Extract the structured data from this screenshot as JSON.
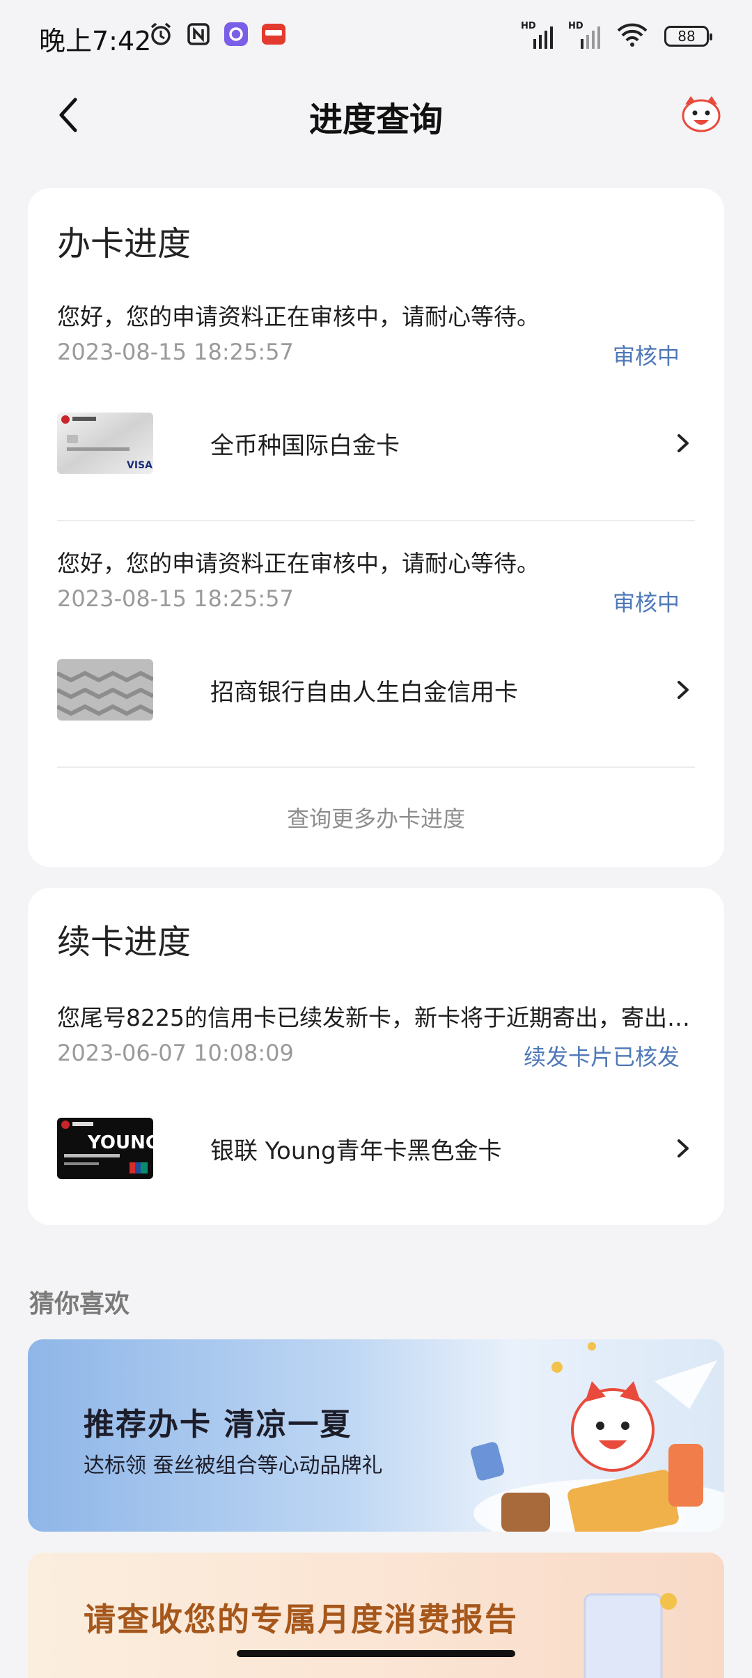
{
  "status_bar": {
    "time": "晚上7:42",
    "battery": "88"
  },
  "nav": {
    "title": "进度查询"
  },
  "apply_progress": {
    "title": "办卡进度",
    "items": [
      {
        "message": "您好，您的申请资料正在审核中，请耐心等待。",
        "timestamp": "2023-08-15 18:25:57",
        "status": "审核中",
        "card_name": "全币种国际白金卡"
      },
      {
        "message": "您好，您的申请资料正在审核中，请耐心等待。",
        "timestamp": "2023-08-15 18:25:57",
        "status": "审核中",
        "card_name": "招商银行自由人生白金信用卡"
      }
    ],
    "more_link": "查询更多办卡进度"
  },
  "renew_progress": {
    "title": "续卡进度",
    "item": {
      "message": "您尾号8225的信用卡已续发新卡，新卡将于近期寄出，寄出…",
      "timestamp": "2023-06-07 10:08:09",
      "status": "续发卡片已核发",
      "card_name": "银联 Young青年卡黑色金卡"
    }
  },
  "recommend": {
    "title": "猜你喜欢",
    "banner1": {
      "title": "推荐办卡 清凉一夏",
      "subtitle": "达标领 蚕丝被组合等心动品牌礼"
    },
    "banner2": {
      "title": "请查收您的专属月度消费报告"
    }
  },
  "colors": {
    "accent": "#4f78b8",
    "background": "#f4f4f6"
  }
}
